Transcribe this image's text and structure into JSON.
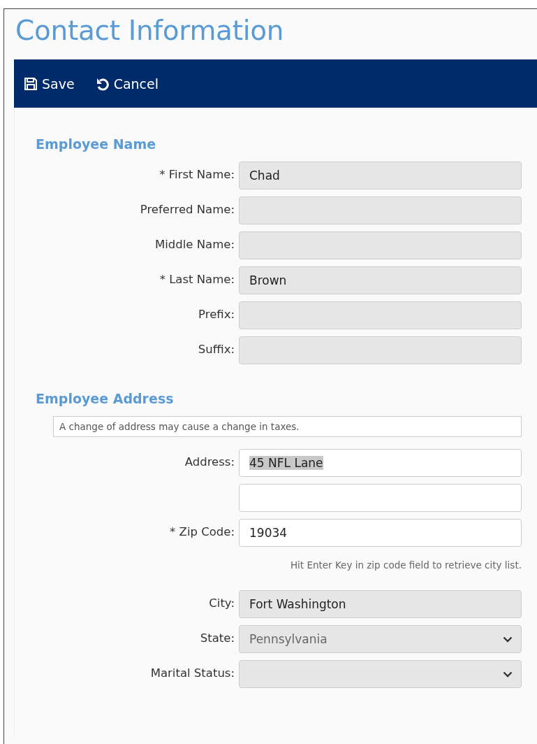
{
  "title": "Contact Information",
  "toolbar": [
    {
      "label": "Save",
      "kind": "save"
    },
    {
      "label": "Cancel",
      "kind": "undo"
    }
  ],
  "sections": [
    {
      "heading": "Employee Name",
      "fields": [
        {
          "kind": "text",
          "label": "* First Name:",
          "value": "Chad",
          "disabled": true
        },
        {
          "kind": "text",
          "label": "Preferred Name:",
          "disabled": true
        },
        {
          "kind": "text",
          "label": "Middle Name:",
          "disabled": true
        },
        {
          "kind": "text",
          "label": "* Last Name:",
          "value": "Brown",
          "disabled": true
        },
        {
          "kind": "text",
          "label": "Prefix:",
          "disabled": true
        },
        {
          "kind": "text",
          "label": "Suffix:",
          "disabled": true
        }
      ]
    },
    {
      "heading": "Employee Address",
      "fields": [
        {
          "kind": "notice",
          "text": "A change of address may cause a change in taxes."
        },
        {
          "kind": "text",
          "label": "Address:",
          "value": "45 NFL Lane",
          "disabled": false,
          "highlighted": true
        },
        {
          "kind": "text",
          "disabled": false
        },
        {
          "kind": "text",
          "label": "* Zip Code:",
          "value": "19034",
          "disabled": false
        },
        {
          "kind": "hint",
          "text": "Hit Enter Key in zip code field to retrieve city list."
        },
        {
          "kind": "text",
          "label": "City:",
          "value": "Fort Washington",
          "disabled": true
        },
        {
          "kind": "select",
          "label": "State:",
          "value": "Pennsylvania",
          "disabled": true
        },
        {
          "kind": "select",
          "label": "Marital Status:",
          "disabled": true
        }
      ]
    }
  ]
}
